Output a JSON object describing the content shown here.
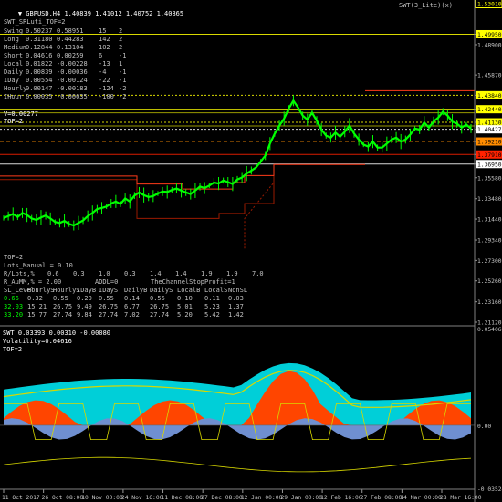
{
  "window": {
    "title_symbol": "GBPUSD,H4",
    "ohlc": "1.40839 1.41012 1.40752 1.40865",
    "top_right": "SWT(3_Lite)(x)"
  },
  "colors": {
    "background": "#000000",
    "price_candles": "#00ff00",
    "yellow": "#ffff00",
    "red_band": "#ff3b1a",
    "dark_red": "#9a1a00",
    "osc_cyan": "#00cfd8",
    "osc_orange": "#ff4500",
    "osc_blue": "#6f8fd0",
    "osc_yellow": "#d8d800"
  },
  "main_panel": {
    "indicator_label": "SWT_SRLuti_TOF=2",
    "table_header": "",
    "table": [
      {
        "name": "Swing",
        "a": "0.50237",
        "b": "0.58951",
        "c": "15",
        "d": "2"
      },
      {
        "name": "Long",
        "a": "0.31180",
        "b": "0.44283",
        "c": "142",
        "d": "2"
      },
      {
        "name": "Medium",
        "a": "0.12844",
        "b": "0.13104",
        "c": "102",
        "d": "2"
      },
      {
        "name": "Short",
        "a": "0.04616",
        "b": "0.00259",
        "c": "6",
        "d": "-1"
      },
      {
        "name": "Local",
        "a": "0.01822",
        "b": "-0.00228",
        "c": "-13",
        "d": "1"
      },
      {
        "name": "Daily",
        "a": "0.00839",
        "b": "-0.00036",
        "c": "-4",
        "d": "-1"
      },
      {
        "name": "IDay",
        "a": "0.00554",
        "b": "-0.00124",
        "c": "-22",
        "d": "-1"
      },
      {
        "name": "Hourly",
        "a": "0.00147",
        "b": "-0.00183",
        "c": "-124",
        "d": "-2"
      },
      {
        "name": "IHour",
        "a": "0.00035",
        "b": "-0.00035",
        "c": "-100",
        "d": "-2"
      }
    ],
    "v_label": "V=0.00277",
    "tof_label": "TOF=2",
    "lower_block": {
      "tof": "TOF=2",
      "lots_manual": "Lots_Manual = 0.10",
      "r_lots_label": "R/Lots,%",
      "r_lots_values": [
        "0.6",
        "0.3",
        "1.0",
        "0.3",
        "1.4",
        "1.4",
        "1.9",
        "1.9",
        "7.0"
      ],
      "r_aumm": "R_AuMM,% = 2.00",
      "addl": "ADDL=0",
      "stop_profit": "TheChannelStopProfit=1",
      "sl_header": [
        "SL_Level:",
        "HourlyS",
        "HourlyS",
        "IDayB",
        "IDayS",
        "DailyB",
        "DailyS",
        "LocalB",
        "LocalS",
        "NonSL"
      ],
      "sl_rows": [
        {
          "color": "#00ff00",
          "cells": [
            "0.66",
            "0.32",
            "0.55",
            "0.20",
            "0.55",
            "0.14",
            "0.55",
            "0.10",
            "0.11",
            "0.03"
          ]
        },
        {
          "color": "#00ff00",
          "cells": [
            "32.03",
            "15.21",
            "26.75",
            "9.49",
            "26.75",
            "6.77",
            "26.75",
            "5.01",
            "5.23",
            "1.37"
          ]
        },
        {
          "color": "#00ff00",
          "cells": [
            "33.20",
            "15.77",
            "27.74",
            "9.84",
            "27.74",
            "7.02",
            "27.74",
            "5.20",
            "5.42",
            "1.42"
          ]
        }
      ]
    },
    "price_axis": {
      "ticks": [
        "1.53010",
        "1.49950",
        "1.48900",
        "1.45870",
        "1.43840",
        "1.42440",
        "1.41130",
        "1.40427",
        "1.39210",
        "1.37910",
        "1.36950",
        "1.35580",
        "1.33480",
        "1.31440",
        "1.29340",
        "1.27300",
        "1.25260",
        "1.23160",
        "1.21120"
      ],
      "highlights": [
        {
          "value": "1.53010",
          "style": "outline"
        },
        {
          "value": "1.49950",
          "style": "yellow"
        },
        {
          "value": "1.43840",
          "style": "yellow"
        },
        {
          "value": "1.42440",
          "style": "yellow"
        },
        {
          "value": "1.41130",
          "style": "yellow"
        },
        {
          "value": "1.40427",
          "style": "white"
        },
        {
          "value": "1.39210",
          "style": "orange"
        },
        {
          "value": "1.37910",
          "style": "red"
        },
        {
          "value": "1.36950",
          "style": "white"
        }
      ]
    }
  },
  "osc_panel": {
    "title": "SWT 0.03393 0.00310 -0.00080",
    "volatility": "Volatility=0.04616",
    "tof": "TOF=2",
    "axis": [
      "0.05406",
      "0.00",
      "-0.03524"
    ]
  },
  "time_axis": [
    "11 Oct 2017",
    "26 Oct 08:00",
    "10 Nov 00:00",
    "24 Nov 16:00",
    "11 Dec 08:00",
    "27 Dec 08:00",
    "12 Jan 00:00",
    "29 Jan 00:00",
    "12 Feb 16:00",
    "27 Feb 08:00",
    "14 Mar 00:00",
    "28 Mar 16:00"
  ],
  "price_series": [
    1.3155,
    1.3175,
    1.3195,
    1.3165,
    1.3205,
    1.3185,
    1.315,
    1.3135,
    1.316,
    1.318,
    1.315,
    1.3115,
    1.3105,
    1.3125,
    1.3095,
    1.308,
    1.3105,
    1.313,
    1.3175,
    1.3205,
    1.3245,
    1.3255,
    1.327,
    1.33,
    1.332,
    1.3295,
    1.335,
    1.332,
    1.338,
    1.341,
    1.3385,
    1.3365,
    1.3375,
    1.34,
    1.342,
    1.3415,
    1.3435,
    1.345,
    1.343,
    1.341,
    1.3395,
    1.343,
    1.347,
    1.3455,
    1.348,
    1.351,
    1.35,
    1.353,
    1.3515,
    1.3495,
    1.354,
    1.356,
    1.36,
    1.363,
    1.366,
    1.372,
    1.378,
    1.39,
    1.4,
    1.408,
    1.415,
    1.425,
    1.433,
    1.426,
    1.418,
    1.414,
    1.421,
    1.413,
    1.404,
    1.398,
    1.396,
    1.401,
    1.397,
    1.402,
    1.408,
    1.4,
    1.394,
    1.389,
    1.387,
    1.392,
    1.386,
    1.386,
    1.39,
    1.394,
    1.396,
    1.392,
    1.394,
    1.399,
    1.405,
    1.404,
    1.411,
    1.406,
    1.412,
    1.416,
    1.422,
    1.418,
    1.412,
    1.41,
    1.406,
    1.409,
    1.405
  ]
}
